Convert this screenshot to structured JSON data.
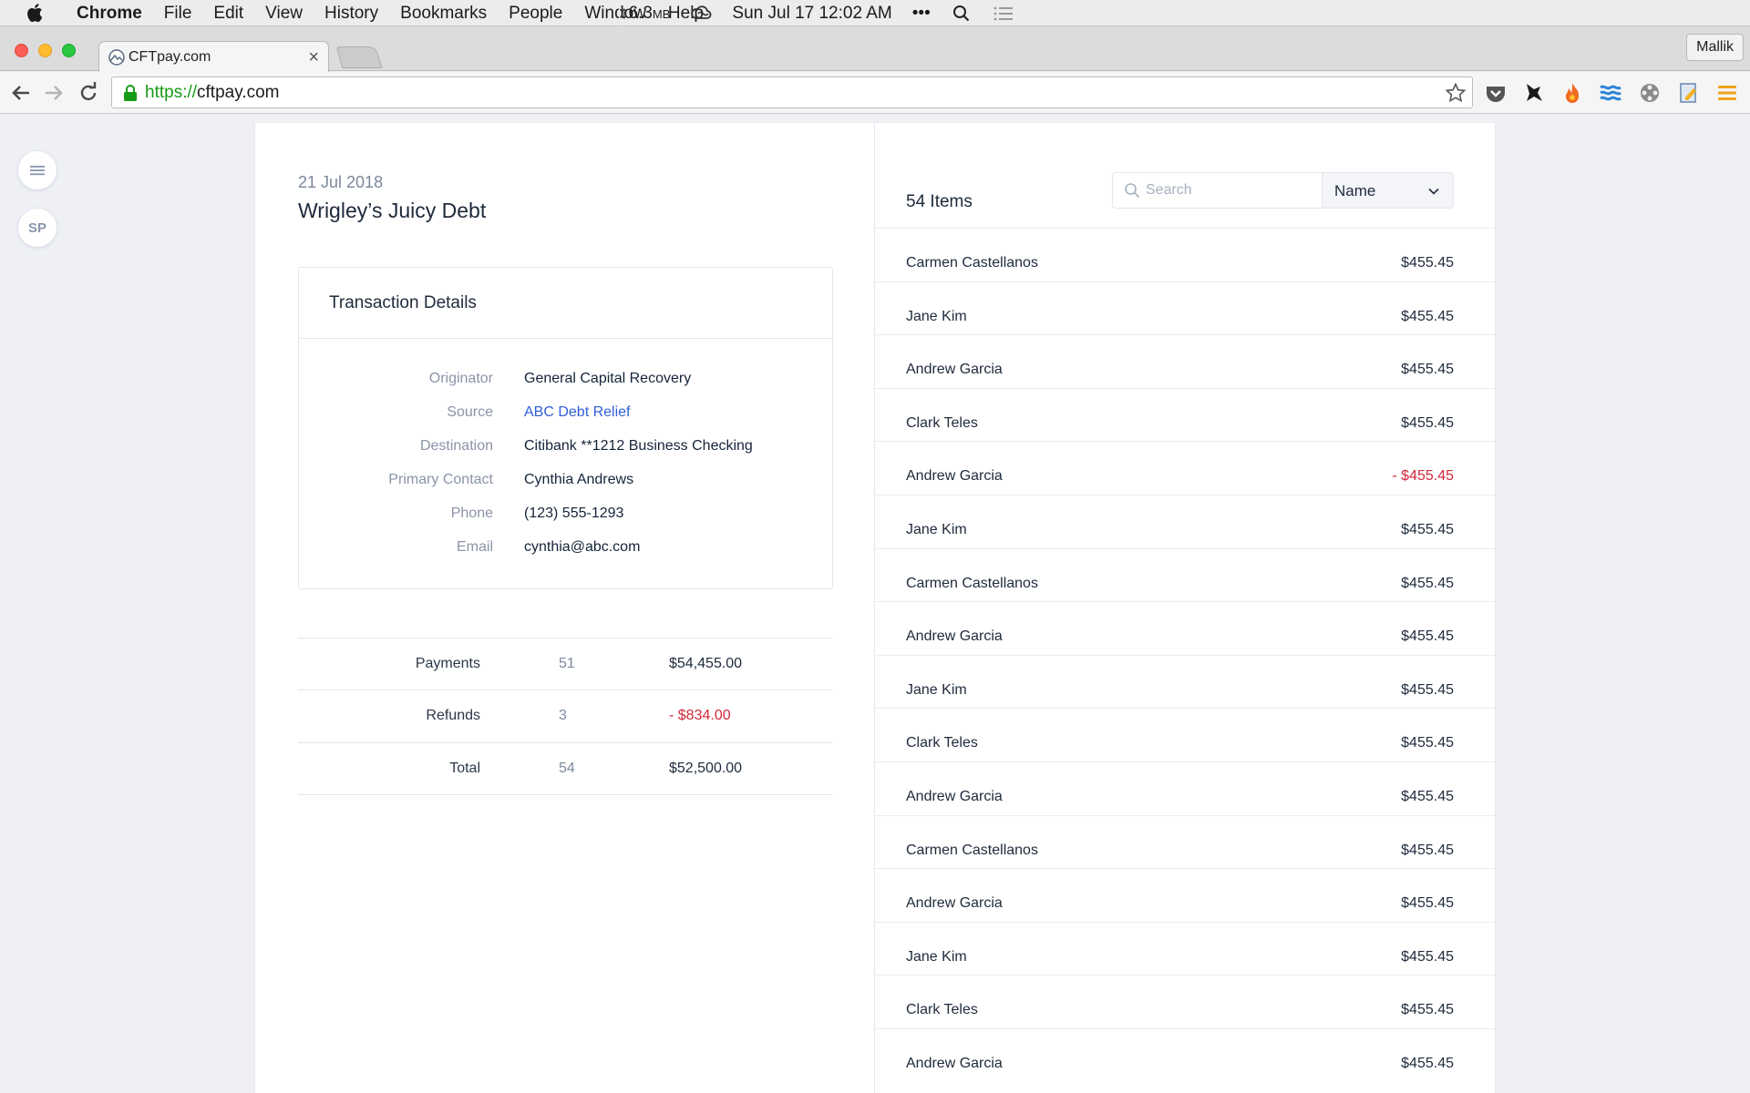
{
  "menubar": {
    "app": "Chrome",
    "items": [
      "File",
      "Edit",
      "View",
      "History",
      "Bookmarks",
      "People",
      "Window",
      "Help"
    ],
    "memory": "↕6.3",
    "memory_unit": "MB",
    "clock": "Sun Jul 17  12:02 AM",
    "dots": "•••"
  },
  "browser": {
    "tab_title": "CFTpay.com",
    "tab_close": "×",
    "profile": "Mallik",
    "url_scheme": "https://",
    "url_host": "cftpay.com"
  },
  "sidebar": {
    "menu_icon": "hamburger-icon",
    "avatar_initials": "SP"
  },
  "debt": {
    "date": "21 Jul 2018",
    "title": "Wrigley’s Juicy Debt"
  },
  "details": {
    "heading": "Transaction Details",
    "rows": [
      {
        "label": "Originator",
        "value": "General Capital Recovery"
      },
      {
        "label": "Source",
        "value": "ABC Debt Relief"
      },
      {
        "label": "Destination",
        "value": "Citibank **1212 Business Checking"
      },
      {
        "label": "Primary Contact",
        "value": "Cynthia Andrews"
      },
      {
        "label": "Phone",
        "value": "(123) 555-1293"
      },
      {
        "label": "Email",
        "value": "cynthia@abc.com"
      }
    ]
  },
  "summary": [
    {
      "label": "Payments",
      "count": "51",
      "amount": "$54,455.00"
    },
    {
      "label": "Refunds",
      "count": "3",
      "amount": "- $834.00"
    },
    {
      "label": "Total",
      "count": "54",
      "amount": "$52,500.00"
    }
  ],
  "items": {
    "count_label": "54 Items",
    "search_placeholder": "Search",
    "sort_value": "Name",
    "rows": [
      {
        "name": "Carmen Castellanos",
        "amount": "$455.45"
      },
      {
        "name": "Jane Kim",
        "amount": "$455.45"
      },
      {
        "name": "Andrew Garcia",
        "amount": "$455.45"
      },
      {
        "name": "Clark Teles",
        "amount": "$455.45"
      },
      {
        "name": "Andrew Garcia",
        "amount": "- $455.45"
      },
      {
        "name": "Jane Kim",
        "amount": "$455.45"
      },
      {
        "name": "Carmen Castellanos",
        "amount": "$455.45"
      },
      {
        "name": "Andrew Garcia",
        "amount": "$455.45"
      },
      {
        "name": "Jane Kim",
        "amount": "$455.45"
      },
      {
        "name": "Clark Teles",
        "amount": "$455.45"
      },
      {
        "name": "Andrew Garcia",
        "amount": "$455.45"
      },
      {
        "name": "Carmen Castellanos",
        "amount": "$455.45"
      },
      {
        "name": "Andrew Garcia",
        "amount": "$455.45"
      },
      {
        "name": "Jane Kim",
        "amount": "$455.45"
      },
      {
        "name": "Clark Teles",
        "amount": "$455.45"
      },
      {
        "name": "Andrew Garcia",
        "amount": "$455.45"
      }
    ]
  },
  "colors": {
    "accent_link": "#2f5ed8",
    "negative": "#d1283a",
    "page_bg": "#eef0f5"
  }
}
